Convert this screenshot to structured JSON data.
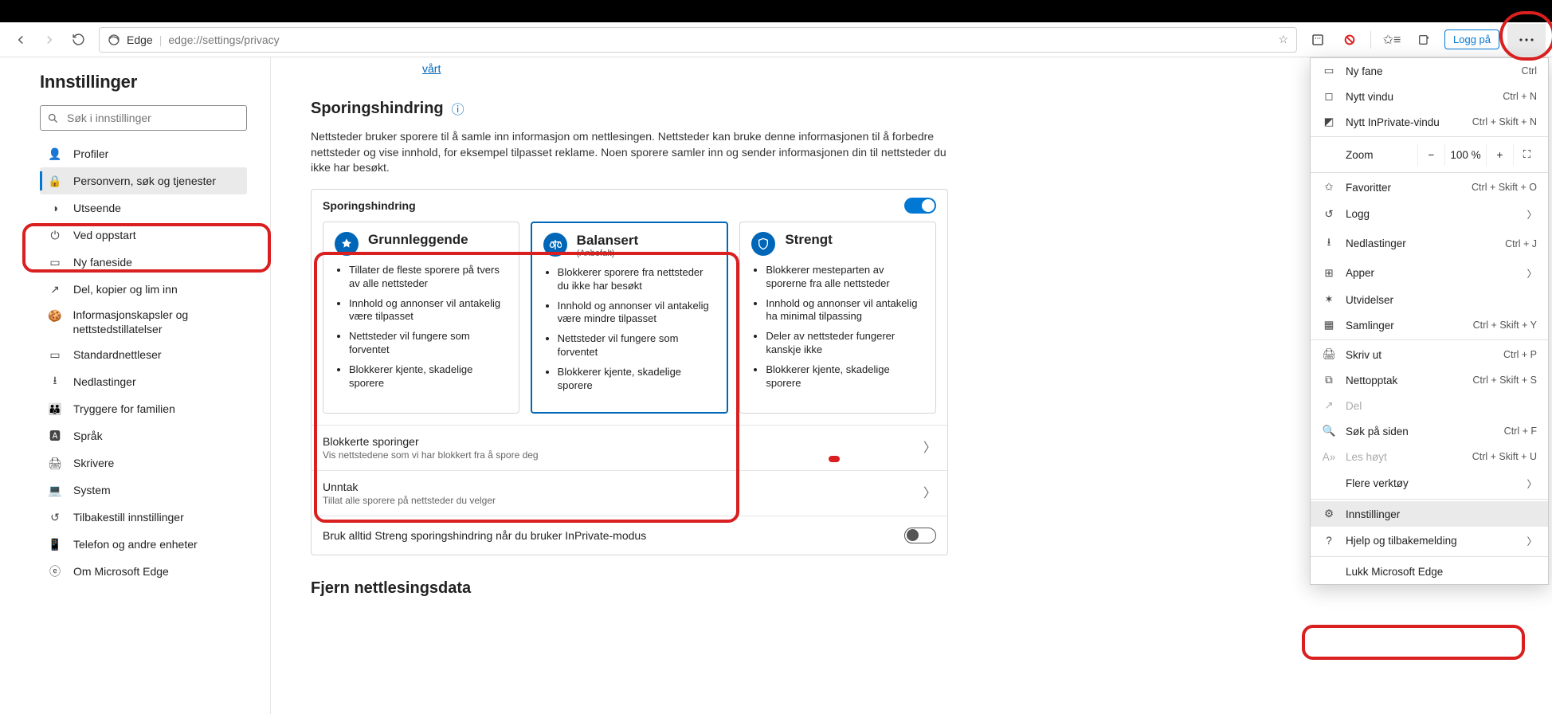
{
  "toolbar": {
    "product": "Edge",
    "url": "edge://settings/privacy",
    "login": "Logg på"
  },
  "sidebar": {
    "title": "Innstillinger",
    "search_placeholder": "Søk i innstillinger",
    "items": [
      "Profiler",
      "Personvern, søk og tjenester",
      "Utseende",
      "Ved oppstart",
      "Ny faneside",
      "Del, kopier og lim inn",
      "Informasjonskapsler og nettstedstillatelser",
      "Standardnettleser",
      "Nedlastinger",
      "Tryggere for familien",
      "Språk",
      "Skrivere",
      "System",
      "Tilbakestill innstillinger",
      "Telefon og andre enheter",
      "Om Microsoft Edge"
    ]
  },
  "content": {
    "top_link": "vårt",
    "tp_title": "Sporingshindring",
    "tp_desc": "Nettsteder bruker sporere til å samle inn informasjon om nettlesingen. Nettsteder kan bruke denne informasjonen til å forbedre nettsteder og vise innhold, for eksempel tilpasset reklame. Noen sporere samler inn og sender informasjonen din til nettsteder du ikke har besøkt.",
    "tp_panel_label": "Sporingshindring",
    "cards": [
      {
        "title": "Grunnleggende",
        "subtitle": "",
        "bullets": [
          "Tillater de fleste sporere på tvers av alle nettsteder",
          "Innhold og annonser vil antakelig være tilpasset",
          "Nettsteder vil fungere som forventet",
          "Blokkerer kjente, skadelige sporere"
        ]
      },
      {
        "title": "Balansert",
        "subtitle": "(Anbefalt)",
        "bullets": [
          "Blokkerer sporere fra nettsteder du ikke har besøkt",
          "Innhold og annonser vil antakelig være mindre tilpasset",
          "Nettsteder vil fungere som forventet",
          "Blokkerer kjente, skadelige sporere"
        ]
      },
      {
        "title": "Strengt",
        "subtitle": "",
        "bullets": [
          "Blokkerer mesteparten av sporerne fra alle nettsteder",
          "Innhold og annonser vil antakelig ha minimal tilpassing",
          "Deler av nettsteder fungerer kanskje ikke",
          "Blokkerer kjente, skadelige sporere"
        ]
      }
    ],
    "blocked": {
      "title": "Blokkerte sporinger",
      "sub": "Vis nettstedene som vi har blokkert fra å spore deg"
    },
    "exceptions": {
      "title": "Unntak",
      "sub": "Tillat alle sporere på nettsteder du velger"
    },
    "inprivate": "Bruk alltid Streng sporingshindring når du bruker InPrivate-modus",
    "clear_title": "Fjern nettlesingsdata"
  },
  "menu": {
    "new_tab": {
      "label": "Ny fane",
      "short": "Ctrl"
    },
    "new_window": {
      "label": "Nytt vindu",
      "short": "Ctrl + N"
    },
    "new_inprivate": {
      "label": "Nytt InPrivate-vindu",
      "short": "Ctrl + Skift + N"
    },
    "zoom": {
      "label": "Zoom",
      "value": "100 %"
    },
    "favorites": {
      "label": "Favoritter",
      "short": "Ctrl + Skift + O"
    },
    "history": {
      "label": "Logg"
    },
    "downloads": {
      "label": "Nedlastinger",
      "short": "Ctrl + J"
    },
    "apps": {
      "label": "Apper"
    },
    "extensions": {
      "label": "Utvidelser"
    },
    "collections": {
      "label": "Samlinger",
      "short": "Ctrl + Skift + Y"
    },
    "print": {
      "label": "Skriv ut",
      "short": "Ctrl + P"
    },
    "webcapture": {
      "label": "Nettopptak",
      "short": "Ctrl + Skift + S"
    },
    "share": {
      "label": "Del"
    },
    "find": {
      "label": "Søk på siden",
      "short": "Ctrl + F"
    },
    "readaloud": {
      "label": "Les høyt",
      "short": "Ctrl + Skift + U"
    },
    "moretools": {
      "label": "Flere verktøy"
    },
    "settings": {
      "label": "Innstillinger"
    },
    "help": {
      "label": "Hjelp og tilbakemelding"
    },
    "close": {
      "label": "Lukk Microsoft Edge"
    }
  }
}
